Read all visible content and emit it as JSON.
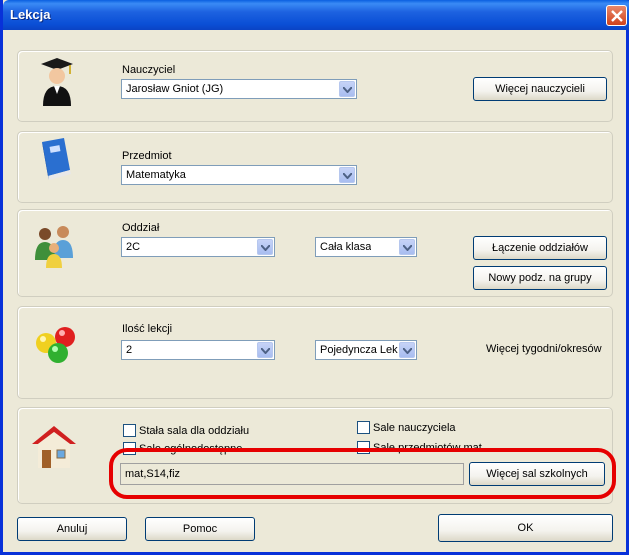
{
  "window": {
    "title": "Lekcja"
  },
  "teacher": {
    "label": "Nauczyciel",
    "value": "Jarosław Gniot (JG)",
    "more_button": "Więcej nauczycieli"
  },
  "subject": {
    "label": "Przedmiot",
    "value": "Matematyka"
  },
  "class": {
    "label": "Oddział",
    "value": "2C",
    "group_value": "Cała klasa",
    "join_button": "Łączenie oddziałów",
    "new_split_button": "Nowy podz. na grupy"
  },
  "lessons": {
    "label": "Ilość lekcji",
    "count_value": "2",
    "type_value": "Pojedyncza Lekc",
    "more_link": "Więcej tygodni/okresów"
  },
  "rooms": {
    "fixed_room": "Stała sala dla oddziału",
    "general_rooms": "Sale ogólnodostępne",
    "teacher_rooms": "Sale nauczyciela",
    "subject_rooms": "Sale przedmiotów mat",
    "value": "mat,S14,fiz",
    "more_button": "Więcej sal szkolnych"
  },
  "footer": {
    "cancel": "Anuluj",
    "help": "Pomoc",
    "ok": "OK"
  },
  "colors": {
    "titlebar": "#0a4fd6",
    "highlight": "#e60000",
    "face": "#ece9d8"
  }
}
